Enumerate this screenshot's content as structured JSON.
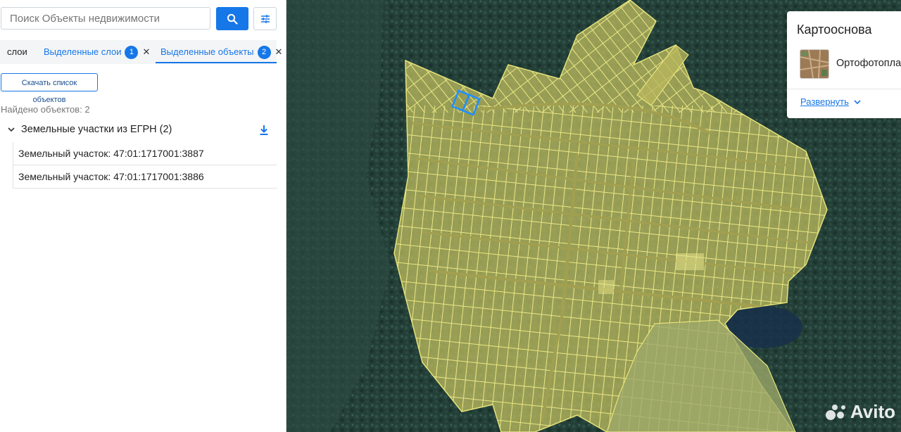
{
  "search": {
    "placeholder": "Поиск Объекты недвижимости"
  },
  "tabs": [
    {
      "label": "слои"
    },
    {
      "label": "Выделенные слои",
      "count": "1"
    },
    {
      "label": "Выделенные объекты",
      "count": "2"
    }
  ],
  "download_list_label": "Скачать список объектов",
  "found_text": "Найдено объектов: 2",
  "group": {
    "title": "Земельные участки из ЕГРН (2)",
    "items": [
      "Земельный участок: 47:01:1717001:3887",
      "Земельный участок: 47:01:1717001:3886"
    ]
  },
  "basemap": {
    "title": "Картооснова",
    "layer": "Ортофотоплан",
    "expand": "Развернуть"
  },
  "watermark": "Avito",
  "colors": {
    "accent": "#1677e8",
    "parcel_fill": "#c9c66a",
    "parcel_line": "#e6e27a",
    "selected_outline": "#1f8fff",
    "forest": "#1f3b34"
  },
  "icons": {
    "search": "search-icon",
    "filter": "filter-icon",
    "close": "close-icon",
    "download": "download-icon",
    "chevron": "chevron-down-icon"
  }
}
